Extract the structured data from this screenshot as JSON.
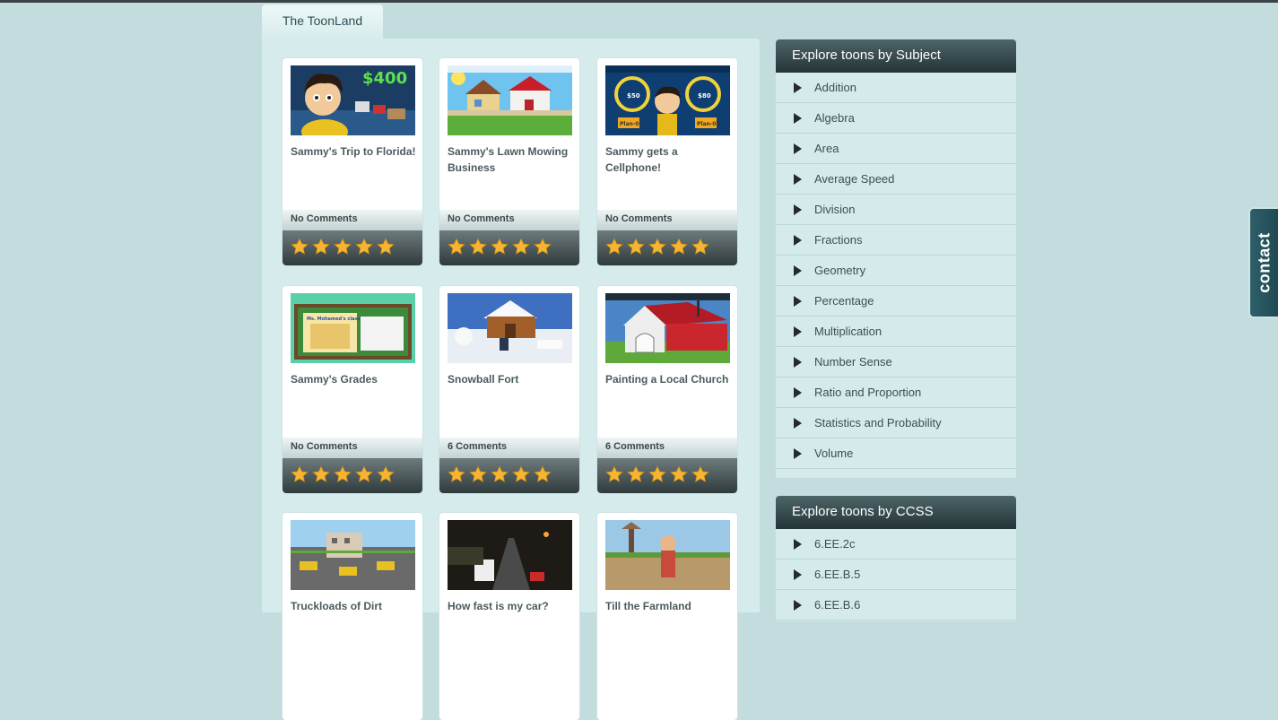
{
  "tab": {
    "label": "The ToonLand"
  },
  "cards": [
    {
      "title": "Sammy's Trip to Florida!",
      "comments": "No Comments",
      "thumb_text": "$400"
    },
    {
      "title": "Sammy's Lawn Mowing Business",
      "comments": "No Comments"
    },
    {
      "title": "Sammy gets a Cellphone!",
      "comments": "No Comments",
      "thumb_text_1": "Plan-01",
      "thumb_text_2": "Plan-02",
      "thumb_price_1": "$50",
      "thumb_price_2": "$80"
    },
    {
      "title": "Sammy's Grades",
      "comments": "No Comments",
      "thumb_text": "Ms. Mohamed's class"
    },
    {
      "title": "Snowball Fort",
      "comments": "6 Comments"
    },
    {
      "title": "Painting a Local Church",
      "comments": "6 Comments"
    },
    {
      "title": "Truckloads of Dirt",
      "comments": ""
    },
    {
      "title": "How fast is my car?",
      "comments": ""
    },
    {
      "title": "Till the Farmland",
      "comments": ""
    }
  ],
  "rating": {
    "stars": 5,
    "max": 5
  },
  "subject_box": {
    "title": "Explore toons by Subject",
    "items": [
      "Addition",
      "Algebra",
      "Area",
      "Average Speed",
      "Division",
      "Fractions",
      "Geometry",
      "Percentage",
      "Multiplication",
      "Number Sense",
      "Ratio and Proportion",
      "Statistics and Probability",
      "Volume"
    ]
  },
  "ccss_box": {
    "title": "Explore toons by CCSS",
    "items": [
      "6.EE.2c",
      "6.EE.B.5",
      "6.EE.B.6"
    ]
  },
  "contact": {
    "label": "contact"
  },
  "colors": {
    "background": "#c3dcdd",
    "panel": "#d6ebec",
    "header_dark": "#243437",
    "star": "#f5b431"
  }
}
